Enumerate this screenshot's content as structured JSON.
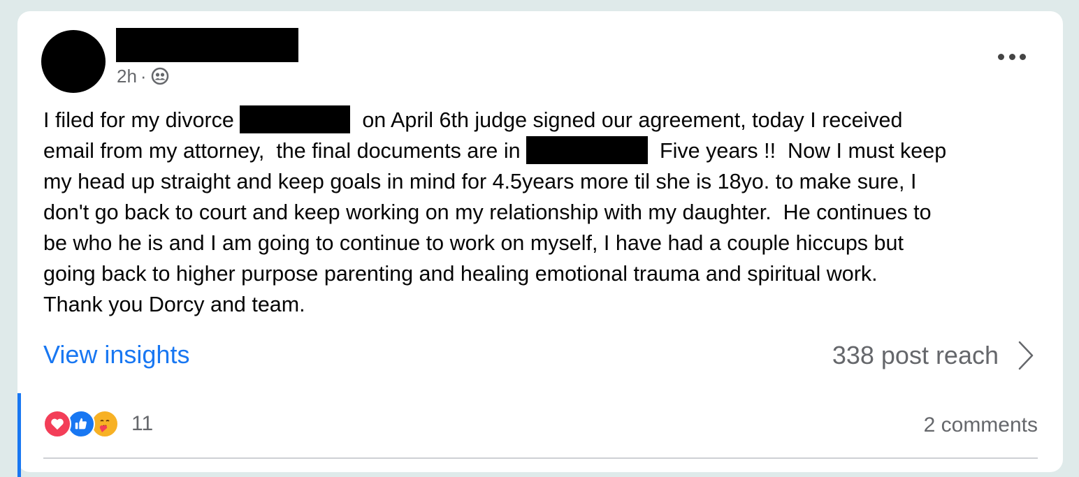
{
  "post": {
    "timestamp": "2h",
    "separator": "·",
    "audience_icon": "friends-icon",
    "more_icon": "more-options-icon",
    "text": {
      "p1": "I filed for my divorce ",
      "p2": "  on April 6th judge signed our agreement, today I received\nemail from my attorney,  the final documents are in ",
      "p3": "  Five years !!  Now I must keep\nmy head up straight and keep goals in mind for 4.5years more til she is 18yo. to make sure, I\ndon't go back to court and keep working on my relationship with my daughter.  He continues to\nbe who he is and I am going to continue to work on myself, I have had a couple hiccups but\ngoing back to higher purpose parenting and healing emotional trauma and spiritual work.\nThank you Dorcy and team."
    }
  },
  "insights": {
    "view_label": "View insights",
    "reach_label": "338 post reach",
    "chevron_icon": "chevron-right-icon"
  },
  "engagement": {
    "reaction_icons": [
      "love-icon",
      "like-icon",
      "care-icon"
    ],
    "reaction_count": "11",
    "comments_label": "2 comments"
  },
  "colors": {
    "page_background": "#dfeaea",
    "card_background": "#ffffff",
    "link_blue": "#1877f2",
    "muted_text": "#65676b",
    "love_red": "#f33e58",
    "care_yellow": "#f7b125"
  }
}
